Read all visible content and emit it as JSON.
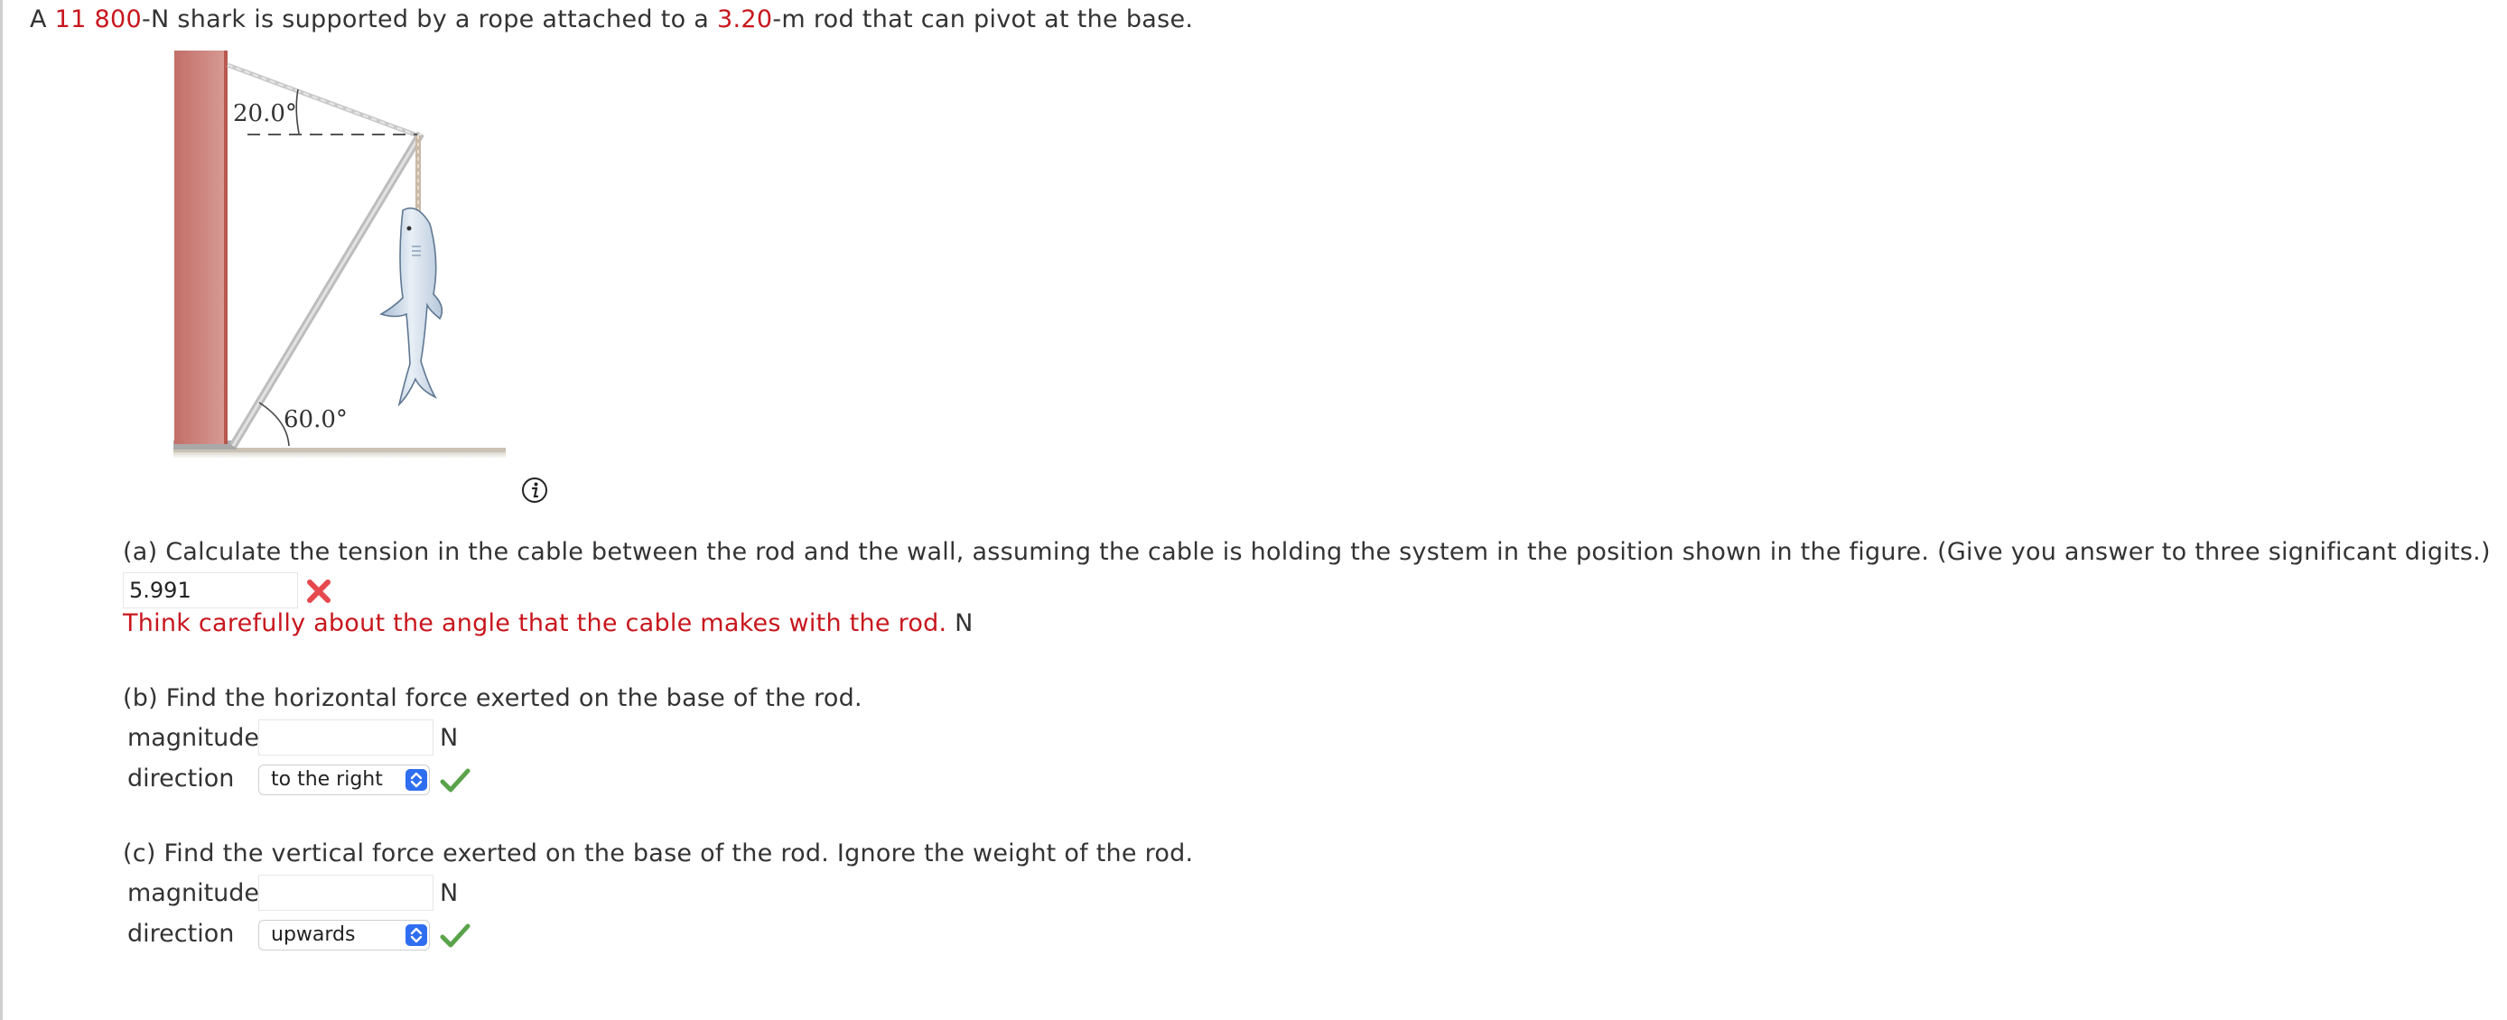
{
  "problem": {
    "intro_prefix": "A ",
    "weight": "11 800",
    "intro_mid": "-N shark is supported by a rope attached to a ",
    "length": "3.20",
    "intro_suffix": "-m rod that can pivot at the base."
  },
  "figure": {
    "angle_top": "20.0°",
    "angle_bottom": "60.0°"
  },
  "part_a": {
    "question": "(a) Calculate the tension in the cable between the rod and the wall, assuming the cable is holding the system in the position shown in the figure. (Give you answer to three significant digits.)",
    "answer": "5.991",
    "feedback": "Think carefully about the angle that the cable makes with the rod.",
    "unit": "N"
  },
  "part_b": {
    "question": "(b) Find the horizontal force exerted on the base of the rod.",
    "magnitude_label": "magnitude",
    "magnitude_value": "",
    "unit": "N",
    "direction_label": "direction",
    "direction_value": "to the right"
  },
  "part_c": {
    "question": "(c) Find the vertical force exerted on the base of the rod. Ignore the weight of the rod.",
    "magnitude_label": "magnitude",
    "magnitude_value": "",
    "unit": "N",
    "direction_label": "direction",
    "direction_value": "upwards"
  },
  "colors": {
    "highlight": "#c8161d",
    "wall": "#c9857f",
    "check": "#5aa34a",
    "cross": "#e5484d",
    "select_arrows": "#2f6ef0"
  },
  "icons": [
    "info-icon",
    "cross-icon",
    "check-icon",
    "select-arrows-icon"
  ]
}
